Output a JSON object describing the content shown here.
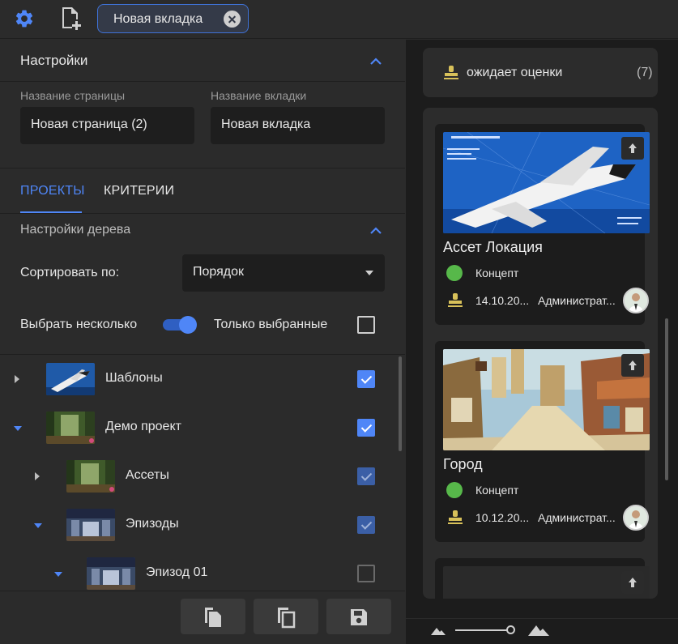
{
  "topbar": {
    "tab_label": "Новая вкладка"
  },
  "settings": {
    "title": "Настройки",
    "page_name_label": "Название страницы",
    "page_name_value": "Новая страница (2)",
    "tab_name_label": "Название вкладки",
    "tab_name_value": "Новая вкладка"
  },
  "tabs": {
    "projects": "ПРОЕКТЫ",
    "criteria": "КРИТЕРИИ"
  },
  "tree_settings": {
    "title": "Настройки дерева",
    "sort_label": "Сортировать по:",
    "sort_value": "Порядок",
    "multi_select_label": "Выбрать несколько",
    "multi_select_on": true,
    "only_selected_label": "Только выбранные",
    "only_selected_checked": false
  },
  "tree": {
    "items": [
      {
        "label": "Шаблоны",
        "expanded": false,
        "checked": true
      },
      {
        "label": "Демо проект",
        "expanded": true,
        "checked": true
      },
      {
        "label": "Ассеты",
        "expanded": false,
        "checked": true
      },
      {
        "label": "Эпизоды",
        "expanded": true,
        "checked": true
      },
      {
        "label": "Эпизод 01",
        "expanded": true,
        "checked": false
      }
    ]
  },
  "right": {
    "status_label": "ожидает оценки",
    "status_count": "(7)",
    "cards": [
      {
        "title": "Ассет Локация",
        "status": "Концепт",
        "date": "14.10.20...",
        "assignee": "Администрат..."
      },
      {
        "title": "Город",
        "status": "Концепт",
        "date": "10.12.20...",
        "assignee": "Администрат..."
      }
    ]
  },
  "colors": {
    "accent": "#4f86f7",
    "status_green": "#57b84a",
    "stamp_yellow": "#d8c15a"
  }
}
